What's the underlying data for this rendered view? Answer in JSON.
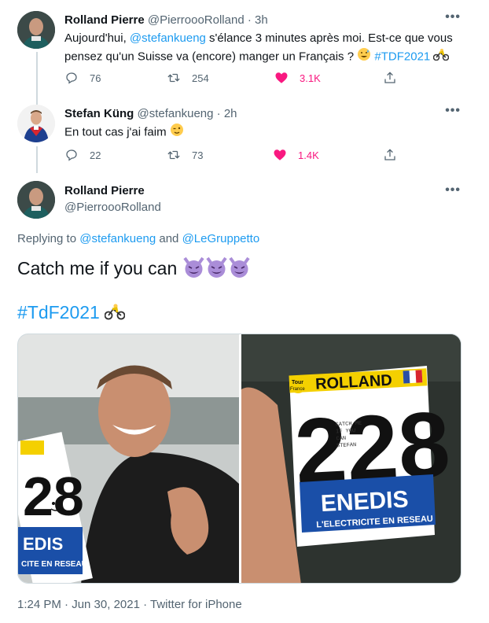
{
  "tweet1": {
    "name": "Rolland Pierre",
    "handle": "@PierroooRolland",
    "time": "· 3h",
    "text_a": "Aujourd'hui, ",
    "mention": "@stefankueng",
    "text_b": " s'élance 3 minutes après moi. Est-ce que vous",
    "text_c": "pensez qu'un Suisse va (encore) manger un Français ? ",
    "hashtag": "#TDF2021",
    "replies": "76",
    "retweets": "254",
    "likes": "3.1K"
  },
  "tweet2": {
    "name": "Stefan Küng",
    "handle": "@stefankueng",
    "time": "· 2h",
    "text": "En tout cas j'ai faim ",
    "replies": "22",
    "retweets": "73",
    "likes": "1.4K"
  },
  "main": {
    "name": "Rolland Pierre",
    "handle": "@PierroooRolland",
    "replying_label": "Replying to ",
    "replying_m1": "@stefankueng",
    "replying_and": " and ",
    "replying_m2": "@LeGruppetto",
    "text": "Catch me if you can ",
    "hashtag": "#TdF2021",
    "footer": "1:24 PM · Jun 30, 2021 · Twitter for iPhone"
  },
  "bib": {
    "name": "ROLLAND",
    "number": "228",
    "brand": "ENEDIS",
    "tagline": "L'ELECTRICITE EN RESEAU",
    "partial_brand": "EDIS",
    "partial_tagline": "CITE EN RESEAU",
    "partial_number": "28",
    "note_l1": "CATCH ME",
    "note_l2": "IF YOU",
    "note_l3": "CAN",
    "note_l4": "STEFAN",
    "logo_l1": "Tour",
    "logo_l2": "France"
  },
  "more_icon": "more-horizontal-icon",
  "colors": {
    "accent": "#1d9bf0",
    "like": "#f91880",
    "muted": "#536471"
  }
}
